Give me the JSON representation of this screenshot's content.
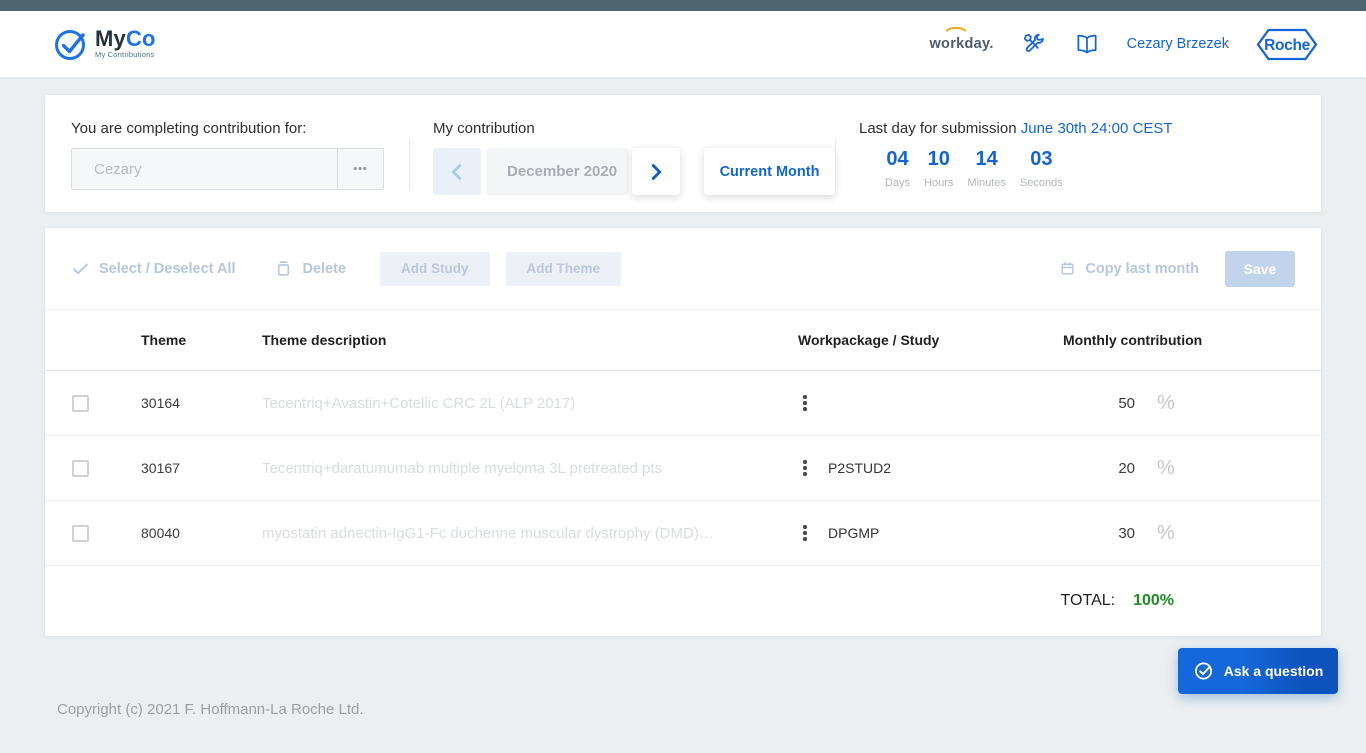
{
  "header": {
    "logo": {
      "name_primary": "My",
      "name_secondary": "Co",
      "subtitle": "My Contributions"
    },
    "workday_label": "workday.",
    "user_name": "Cezary Brzezek",
    "roche_label": "Roche"
  },
  "contribution_bar": {
    "for_label": "You are completing contribution for:",
    "person_value": "Cezary",
    "my_contribution_label": "My contribution",
    "month_value": "December 2020",
    "current_month_label": "Current Month",
    "deadline_label": "Last day for submission",
    "deadline_value": "June 30th 24:00 CEST",
    "countdown": [
      {
        "value": "04",
        "unit": "Days"
      },
      {
        "value": "10",
        "unit": "Hours"
      },
      {
        "value": "14",
        "unit": "Minutes"
      },
      {
        "value": "03",
        "unit": "Seconds"
      }
    ]
  },
  "toolbar": {
    "select_all_label": "Select / Deselect All",
    "delete_label": "Delete",
    "add_study_label": "Add Study",
    "add_theme_label": "Add Theme",
    "copy_last_month_label": "Copy last month",
    "save_label": "Save"
  },
  "table": {
    "columns": [
      "Theme",
      "Theme description",
      "Workpackage / Study",
      "Monthly contribution"
    ],
    "rows": [
      {
        "theme": "30164",
        "description": "Tecentriq+Avastin+Cotellic CRC 2L (ALP 2017)",
        "study": "",
        "contribution": "50",
        "unit": "%"
      },
      {
        "theme": "30167",
        "description": "Tecentriq+daratumumab multiple myeloma 3L pretreated pts",
        "study": "P2STUD2",
        "contribution": "20",
        "unit": "%"
      },
      {
        "theme": "80040",
        "description": "myostatin adnectin-IgG1-Fc duchenne muscular dystrophy (DMD)…",
        "study": "DPGMP",
        "contribution": "30",
        "unit": "%"
      }
    ],
    "total_label": "TOTAL:",
    "total_value": "100%"
  },
  "ask_question_label": "Ask a question",
  "footer": {
    "copyright": "Copyright (c) 2021 F. Hoffmann-La Roche Ltd."
  },
  "icons": {
    "ellipsis": "•••"
  },
  "colors": {
    "topbar": "#4d6670",
    "accent_blue": "#1565d8",
    "countdown_blue": "#1464d8",
    "disabled_blue": "#b9c8de",
    "success_green": "#1f8b24",
    "workday_orange": "#f5a623",
    "page_background": "#eceff1"
  }
}
